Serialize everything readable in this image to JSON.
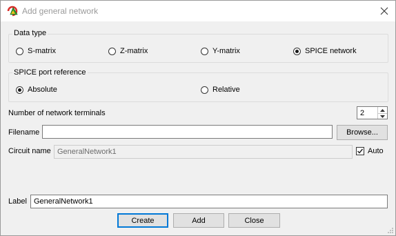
{
  "window": {
    "title": "Add general network"
  },
  "data_type": {
    "title": "Data type",
    "options": [
      "S-matrix",
      "Z-matrix",
      "Y-matrix",
      "SPICE network"
    ],
    "selected": "SPICE network"
  },
  "spice_port_reference": {
    "title": "SPICE port reference",
    "options": [
      "Absolute",
      "Relative"
    ],
    "selected": "Absolute"
  },
  "terminals": {
    "label": "Number of network terminals",
    "value": "2"
  },
  "filename": {
    "label": "Filename",
    "value": "",
    "browse_label": "Browse..."
  },
  "circuit_name": {
    "label": "Circuit name",
    "value": "GeneralNetwork1",
    "auto_label": "Auto",
    "auto_checked": true
  },
  "label_field": {
    "label": "Label",
    "value": "GeneralNetwork1"
  },
  "buttons": {
    "create": "Create",
    "add": "Add",
    "close": "Close"
  },
  "colors": {
    "dialog_bg": "#f0f0f0",
    "focus_border": "#0078d7",
    "title_text": "#9a9a9a"
  },
  "icons": {
    "app": "app-logo-icon",
    "close": "close-icon",
    "spin_up": "chevron-up-icon",
    "spin_down": "chevron-down-icon",
    "check": "checkmark-icon"
  }
}
